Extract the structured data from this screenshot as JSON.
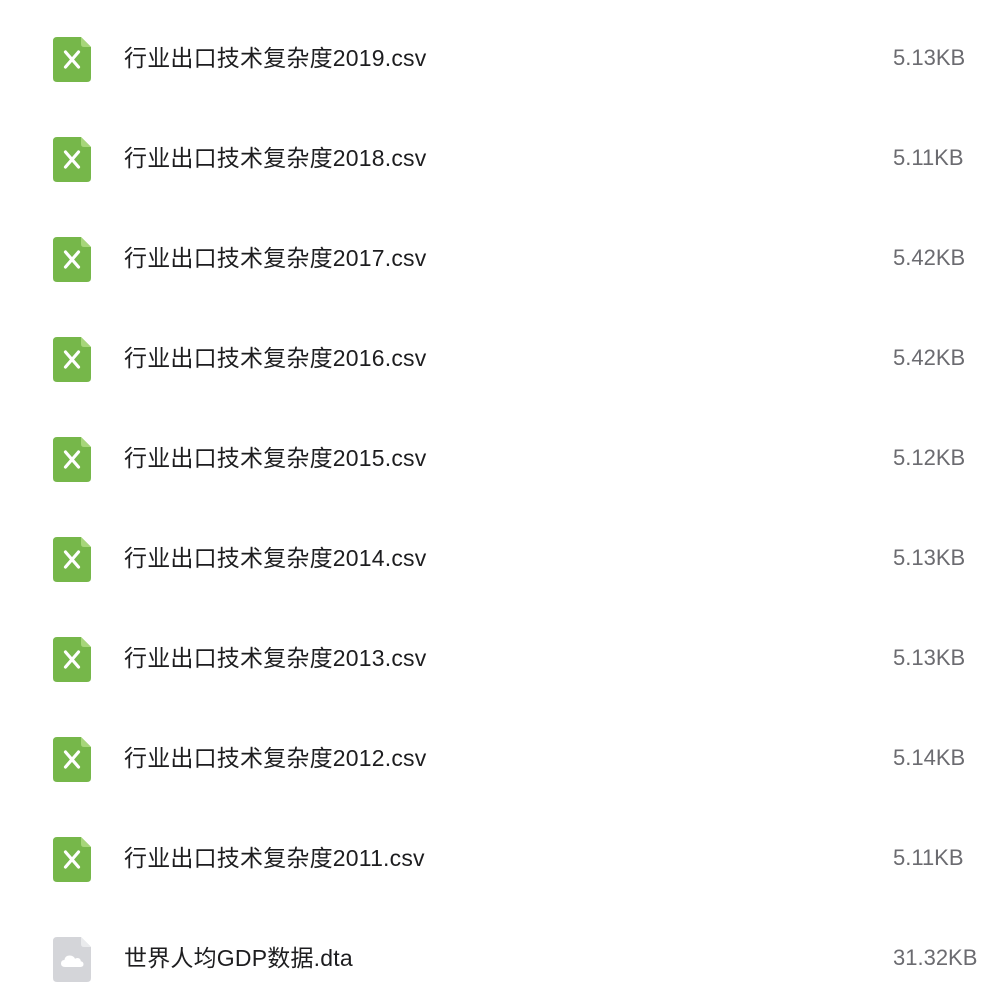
{
  "colors": {
    "spreadsheet_icon": "#76b74a",
    "spreadsheet_fold": "#a6d67a",
    "data_icon": "#d4d5d9",
    "data_fold": "#eaebed",
    "name_text": "#1d1d1f",
    "size_text": "#6b6b70"
  },
  "files": [
    {
      "name": "行业出口技术复杂度2019.csv",
      "size": "5.13KB",
      "icon": "spreadsheet-icon"
    },
    {
      "name": "行业出口技术复杂度2018.csv",
      "size": "5.11KB",
      "icon": "spreadsheet-icon"
    },
    {
      "name": "行业出口技术复杂度2017.csv",
      "size": "5.42KB",
      "icon": "spreadsheet-icon"
    },
    {
      "name": "行业出口技术复杂度2016.csv",
      "size": "5.42KB",
      "icon": "spreadsheet-icon"
    },
    {
      "name": "行业出口技术复杂度2015.csv",
      "size": "5.12KB",
      "icon": "spreadsheet-icon"
    },
    {
      "name": "行业出口技术复杂度2014.csv",
      "size": "5.13KB",
      "icon": "spreadsheet-icon"
    },
    {
      "name": "行业出口技术复杂度2013.csv",
      "size": "5.13KB",
      "icon": "spreadsheet-icon"
    },
    {
      "name": "行业出口技术复杂度2012.csv",
      "size": "5.14KB",
      "icon": "spreadsheet-icon"
    },
    {
      "name": "行业出口技术复杂度2011.csv",
      "size": "5.11KB",
      "icon": "spreadsheet-icon"
    },
    {
      "name": "世界人均GDP数据.dta",
      "size": "31.32KB",
      "icon": "cloud-file-icon"
    }
  ]
}
